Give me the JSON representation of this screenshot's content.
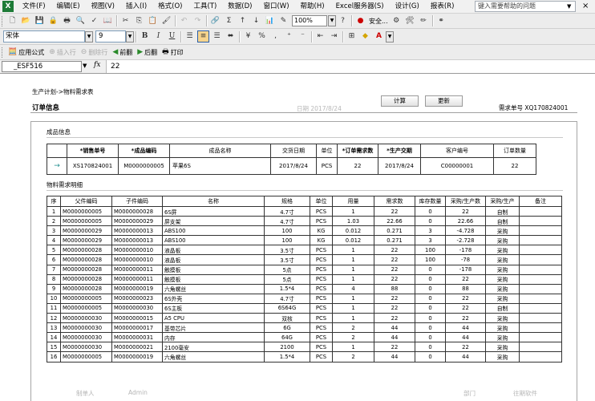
{
  "menubar": {
    "items": [
      "文件(F)",
      "编辑(E)",
      "视图(V)",
      "插入(I)",
      "格式(O)",
      "工具(T)",
      "数据(D)",
      "窗口(W)",
      "帮助(H)",
      "Excel服务器(S)",
      "设计(G)",
      "报表(R)"
    ],
    "help_placeholder": "键入需要帮助的问题"
  },
  "toolbar1": {
    "zoom": "100%",
    "security": "安全..."
  },
  "toolbar2": {
    "font": "宋体",
    "size": "9"
  },
  "toolbar3": {
    "commands": [
      "应用公式",
      "插入行",
      "删除行",
      "前翻",
      "后翻",
      "打印"
    ]
  },
  "formula_bar": {
    "cell_ref": "_ESF516",
    "fx": "fx",
    "value": "22"
  },
  "page": {
    "breadcrumb": "生产计划->物料需求表",
    "order_title": "订单信息",
    "date": "日期 2017/8/24",
    "buttons": [
      "计算",
      "更新"
    ],
    "demand_no": "需求单号 XQ170824001"
  },
  "finished_goods": {
    "section_title": "成品信息",
    "headers": [
      "*销售单号",
      "*成品编码",
      "成品名称",
      "交货日期",
      "单位",
      "*订单需求数",
      "*生产交期",
      "客户编号",
      "订单数量"
    ],
    "row": [
      "XS170824001",
      "M0000000005",
      "苹果6S",
      "2017/8/24",
      "PCS",
      "22",
      "2017/8/24",
      "C00000001",
      "22"
    ]
  },
  "materials": {
    "section_title": "物料需求明细",
    "headers": [
      "序",
      "父件编码",
      "子件编码",
      "名称",
      "规格",
      "单位",
      "用量",
      "需求数",
      "库存数量",
      "采购/生产数",
      "采购/生产",
      "备注"
    ],
    "rows": [
      [
        "1",
        "M0000000005",
        "M0000000028",
        "6S屏",
        "4.7寸",
        "PCS",
        "1",
        "22",
        "0",
        "22",
        "自制",
        ""
      ],
      [
        "2",
        "M0000000005",
        "M0000000029",
        "屏支架",
        "4.7寸",
        "PCS",
        "1.03",
        "22.66",
        "0",
        "22.66",
        "自制",
        ""
      ],
      [
        "3",
        "M0000000029",
        "M0000000013",
        "ABS100",
        "100",
        "KG",
        "0.012",
        "0.271",
        "3",
        "-4.728",
        "采购",
        ""
      ],
      [
        "4",
        "M0000000029",
        "M0000000013",
        "ABS100",
        "100",
        "KG",
        "0.012",
        "0.271",
        "3",
        "-2.728",
        "采购",
        ""
      ],
      [
        "5",
        "M0000000028",
        "M0000000010",
        "液晶板",
        "3.5寸",
        "PCS",
        "1",
        "22",
        "100",
        "-178",
        "采购",
        ""
      ],
      [
        "6",
        "M0000000028",
        "M0000000010",
        "液晶板",
        "3.5寸",
        "PCS",
        "1",
        "22",
        "100",
        "-78",
        "采购",
        ""
      ],
      [
        "7",
        "M0000000028",
        "M0000000011",
        "触摸板",
        "5点",
        "PCS",
        "1",
        "22",
        "0",
        "-178",
        "采购",
        ""
      ],
      [
        "8",
        "M0000000028",
        "M0000000011",
        "触摸板",
        "5点",
        "PCS",
        "1",
        "22",
        "0",
        "22",
        "采购",
        ""
      ],
      [
        "9",
        "M0000000028",
        "M0000000019",
        "六角螺丝",
        "1.5*4",
        "PCS",
        "4",
        "88",
        "0",
        "88",
        "采购",
        ""
      ],
      [
        "10",
        "M0000000005",
        "M0000000023",
        "6S外壳",
        "4.7寸",
        "PCS",
        "1",
        "22",
        "0",
        "22",
        "采购",
        ""
      ],
      [
        "11",
        "M0000000005",
        "M0000000030",
        "6S主板",
        "6S64G",
        "PCS",
        "1",
        "22",
        "0",
        "22",
        "自制",
        ""
      ],
      [
        "12",
        "M0000000030",
        "M0000000015",
        "A5 CPU",
        "双核",
        "PCS",
        "1",
        "22",
        "0",
        "22",
        "采购",
        ""
      ],
      [
        "13",
        "M0000000030",
        "M0000000017",
        "基带芯片",
        "6G",
        "PCS",
        "2",
        "44",
        "0",
        "44",
        "采购",
        ""
      ],
      [
        "14",
        "M0000000030",
        "M0000000031",
        "内存",
        "64G",
        "PCS",
        "2",
        "44",
        "0",
        "44",
        "采购",
        ""
      ],
      [
        "15",
        "M0000000030",
        "M0000000021",
        "2100毫安",
        "2100",
        "PCS",
        "1",
        "22",
        "0",
        "22",
        "采购",
        ""
      ],
      [
        "16",
        "M0000000005",
        "M0000000019",
        "六角螺丝",
        "1.5*4",
        "PCS",
        "2",
        "44",
        "0",
        "44",
        "采购",
        ""
      ]
    ]
  },
  "footer": {
    "preparer_label": "制单人",
    "preparer": "Admin",
    "dept_label": "部门",
    "related": "往期软件"
  }
}
